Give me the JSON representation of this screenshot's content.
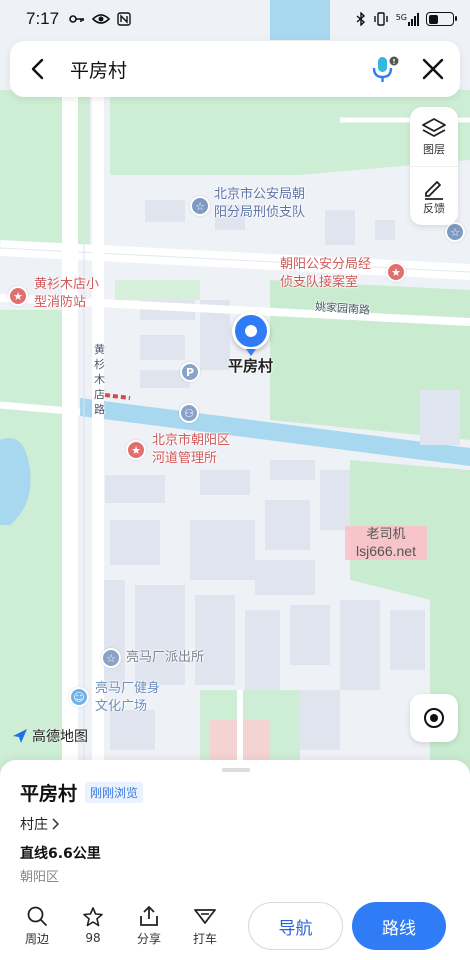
{
  "status_bar": {
    "time": "7:17",
    "left_icons": [
      "key-icon",
      "eye-icon",
      "nfc-icon"
    ],
    "right_icons": [
      "bluetooth-icon",
      "vibrate-icon",
      "signal-5g-icon"
    ],
    "network": "5G"
  },
  "search": {
    "query": "平房村",
    "icons": [
      "back-icon",
      "voice-input-icon",
      "close-icon"
    ]
  },
  "tools": [
    {
      "label": "图层",
      "icon": "layers-icon"
    },
    {
      "label": "反馈",
      "icon": "feedback-pen-icon"
    }
  ],
  "map": {
    "labels": {
      "police_bureau": [
        "北京市公安局朝",
        "阳分局刑侦支队"
      ],
      "chaoyang_police": [
        "朝阳公安分局经",
        "侦支队接案室"
      ],
      "fire_station": [
        "黄衫木店小",
        "型消防站"
      ],
      "yaojiayuan_road": "姚家园南路",
      "huangshanmudian_road": [
        "黄",
        "杉",
        "木",
        "店",
        "路"
      ],
      "pin_name": "平房村",
      "river_office": [
        "北京市朝阳区",
        "河道管理所"
      ],
      "police_station": "亮马厂派出所",
      "culture_square": [
        "亮马厂健身",
        "文化广场"
      ]
    },
    "watermark": {
      "line1": "老司机",
      "line2": "lsj666.net"
    },
    "brand": "高德地图",
    "colors": {
      "water": "#a8d8f0",
      "green": "#c9ecd0",
      "road": "#ffffff",
      "pin": "#2f7cf6"
    }
  },
  "place": {
    "name": "平房村",
    "badge": "刚刚浏览",
    "category": "村庄",
    "distance": "直线6.6公里",
    "district": "朝阳区"
  },
  "actions": [
    {
      "label": "周边",
      "icon": "search-icon"
    },
    {
      "label": "98",
      "icon": "star-icon"
    },
    {
      "label": "分享",
      "icon": "share-icon"
    },
    {
      "label": "打车",
      "icon": "taxi-icon"
    }
  ],
  "nav_label": "导航",
  "route_label": "路线"
}
